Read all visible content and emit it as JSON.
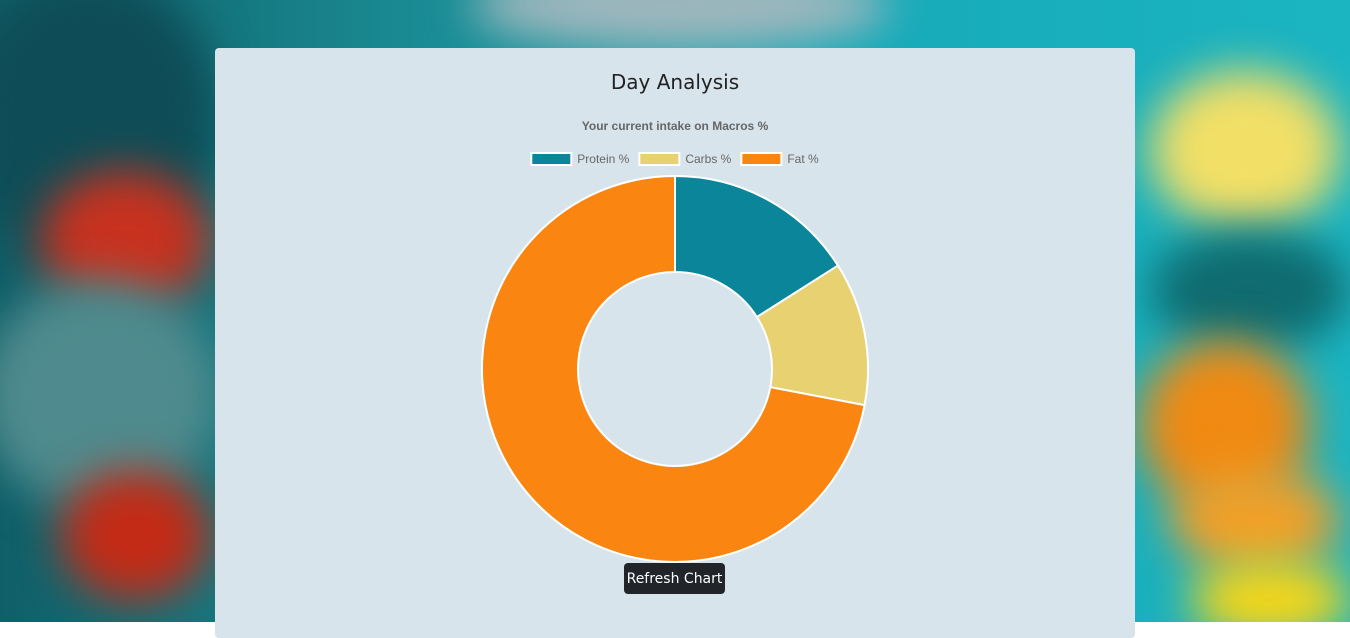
{
  "page": {
    "title": "Day Analysis",
    "refresh_label": "Refresh Chart"
  },
  "colors": {
    "protein": "#0b8599",
    "carbs": "#e8d170",
    "fat": "#fa8511",
    "card": "#d8e4ec",
    "button": "#212529"
  },
  "chart_data": {
    "type": "pie",
    "variant": "doughnut",
    "title": "Your current intake on Macros %",
    "legend_position": "top",
    "labels": [
      "Protein %",
      "Carbs %",
      "Fat %"
    ],
    "values": [
      16,
      12,
      72
    ]
  }
}
